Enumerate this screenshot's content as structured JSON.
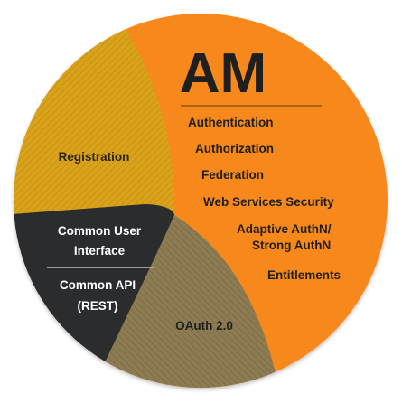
{
  "title": "AM",
  "registration": "Registration",
  "am_features": [
    "Authentication",
    "Authorization",
    "Federation",
    "Web Services Security",
    "Adaptive AuthN/",
    "Strong AuthN",
    "Entitlements"
  ],
  "common_user_interface": [
    "Common User",
    "Interface"
  ],
  "common_api": [
    "Common API",
    "(REST)"
  ],
  "oauth": "OAuth 2.0",
  "colors": {
    "orange": "#f7891f",
    "gold": "#d9a21b",
    "olive": "#8a7a52",
    "dark": "#2b2c2e",
    "text_dark": "#1f1f1f",
    "text_light": "#ffffff"
  }
}
